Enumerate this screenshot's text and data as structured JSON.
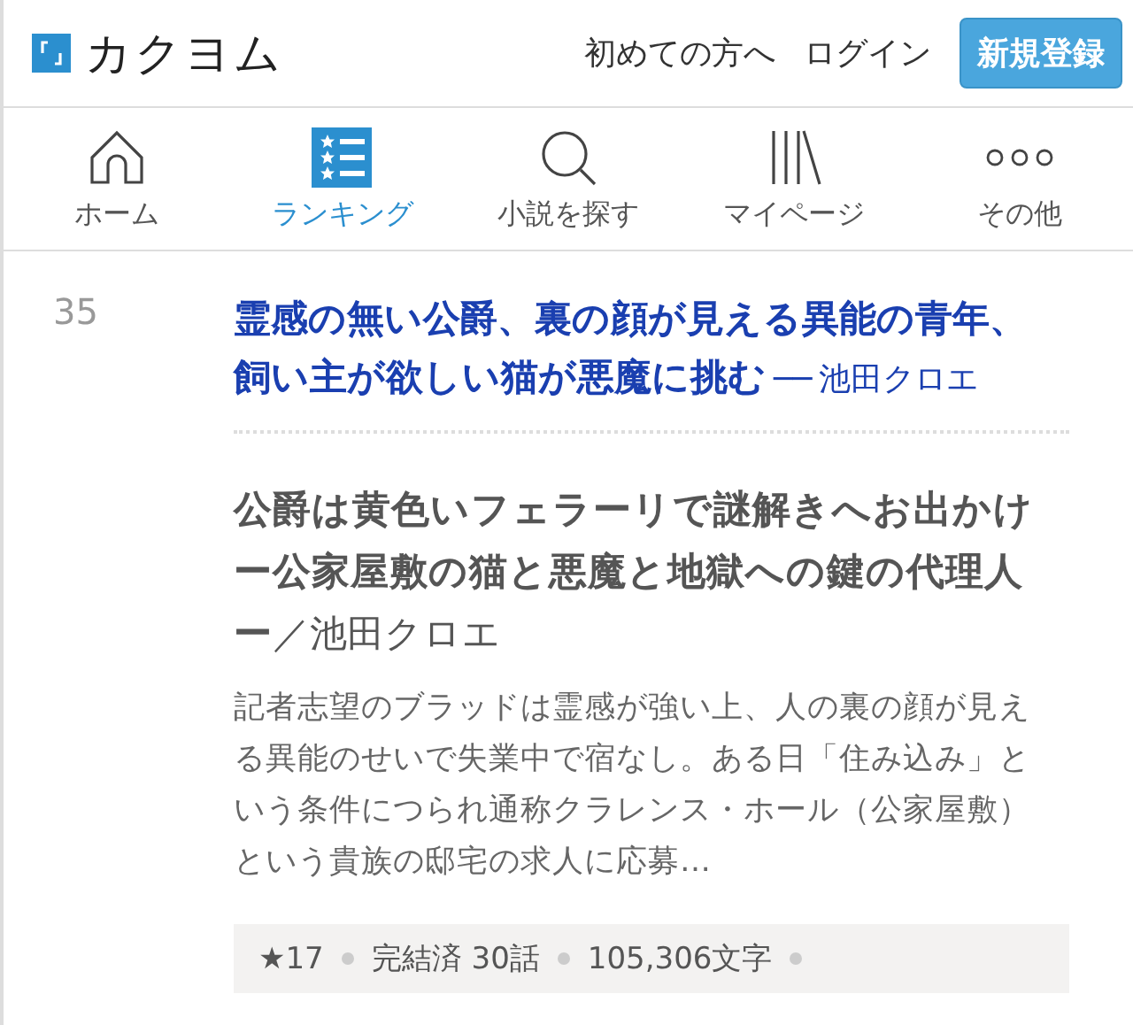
{
  "header": {
    "logo_text": "カクヨム",
    "links": [
      "初めての方へ",
      "ログイン"
    ],
    "register_button": "新規登録"
  },
  "nav": [
    {
      "kind": "home",
      "label": "ホーム",
      "selected": false
    },
    {
      "kind": "ranking",
      "label": "ランキング",
      "selected": true
    },
    {
      "kind": "search",
      "label": "小説を探す",
      "selected": false
    },
    {
      "kind": "mypage",
      "label": "マイページ",
      "selected": false
    },
    {
      "kind": "more",
      "label": "その他",
      "selected": false
    }
  ],
  "entry": {
    "rank": "35",
    "title": "霊感の無い公爵、裏の顔が見える異能の青年、飼い主が欲しい猫が悪魔に挑む",
    "dash": "──",
    "author": "池田クロエ",
    "work": {
      "title": "公爵は黄色いフェラーリで謎解きへお出かけー公家屋敷の猫と悪魔と地獄への鍵の代理人ー",
      "separator": "／",
      "author": "池田クロエ",
      "description": "記者志望のブラッドは霊感が強い上、人の裏の顔が見える異能のせいで失業中で宿なし。ある日「住み込み」という条件につられ通称クラレンス・ホール（公家屋敷）という貴族の邸宅の求人に応募…",
      "stats": [
        "★17",
        "完結済 30話",
        "105,306文字"
      ]
    }
  }
}
